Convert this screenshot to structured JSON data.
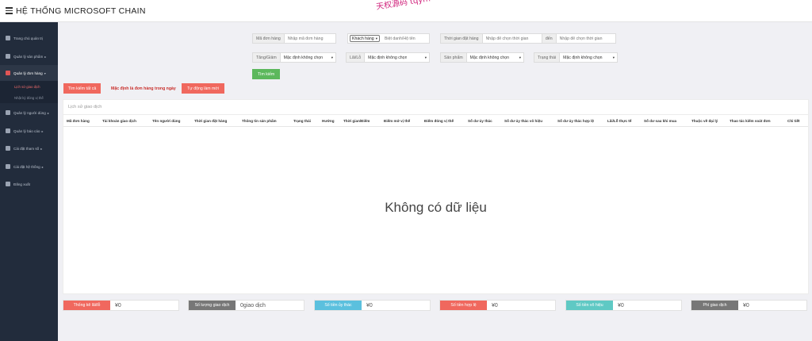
{
  "topbar": {
    "title": "HỆ THỐNG MICROSOFT CHAIN",
    "watermark": "天权源码 tqym"
  },
  "sidebar": {
    "items": [
      {
        "label": "Trang chủ quản trị",
        "chevron": ""
      },
      {
        "label": "Quản lý sản phẩm",
        "chevron": "▸"
      },
      {
        "label": "Quản lý đơn hàng",
        "chevron": "▾"
      },
      {
        "label": "Quản lý người dùng",
        "chevron": "▸"
      },
      {
        "label": "Quản lý báo cáo",
        "chevron": "▸"
      },
      {
        "label": "Cài đặt tham số",
        "chevron": "▸"
      },
      {
        "label": "Cài đặt hệ thống",
        "chevron": "▸"
      },
      {
        "label": "Đăng xuất",
        "chevron": ""
      }
    ],
    "sub_items": [
      "Lịch sử giao dịch",
      "Nhật ký đóng vị thế"
    ]
  },
  "filters": {
    "order_code": {
      "label": "Mã đơn hàng",
      "placeholder": "Nhập mã đơn hàng"
    },
    "customer": {
      "select": "Khách hàng",
      "placeholder": "Biệt danh/Hộ tên"
    },
    "order_time": {
      "label": "Thời gian đặt hàng",
      "placeholder_from": "Nhập để chọn thời gian",
      "sep": "đến",
      "placeholder_to": "Nhập để chọn thời gian"
    },
    "direction": {
      "label": "Tăng/Giảm",
      "value": "Mặc định không chọn"
    },
    "pnl": {
      "label": "Lãi/Lỗ",
      "value": "Mặc định không chọn"
    },
    "product": {
      "label": "Sản phẩm",
      "value": "Mặc định không chọn"
    },
    "status": {
      "label": "Trạng thái",
      "value": "Mặc định không chọn"
    },
    "search_button": "Tìm kiếm"
  },
  "actions": {
    "search_all": "Tìm kiếm tất cả",
    "note": "Mặc định là đơn hàng trong ngày",
    "auto_refresh": "Tự động làm mới"
  },
  "table": {
    "title": "Lịch sử giao dịch",
    "columns": [
      "Mã đơn hàng",
      "Tài khoản giao dịch",
      "Tên người dùng",
      "Thời gian đặt hàng",
      "Thông tin sản phẩm",
      "Trạng thái",
      "Hướng",
      "Thời gian/Điểm",
      "Điểm mở vị thế",
      "Điểm đóng vị thế",
      "Số dư ủy thác",
      "Số dư ủy thác vô hiệu",
      "Số dư ủy thác hợp lệ",
      "Lãi/Lỗ thực tế",
      "Số dư sau khi mua",
      "Thuộc về đại lý",
      "Thao tác kiểm soát đơn",
      "Chi tiết"
    ],
    "empty_text": "Không có dữ liệu"
  },
  "stats": [
    {
      "label": "Thống kê lãi/lỗ",
      "value": "¥0",
      "color": "#f0685e"
    },
    {
      "label": "Số lượng giao dịch",
      "value": "0giao dịch",
      "color": "#777777"
    },
    {
      "label": "Số tiền ủy thác",
      "value": "¥0",
      "color": "#5bc0de"
    },
    {
      "label": "Số tiền hợp lệ",
      "value": "¥0",
      "color": "#f0685e"
    },
    {
      "label": "Số tiền vô hiệu",
      "value": "¥0",
      "color": "#5fc9c4"
    },
    {
      "label": "Phí giao dịch",
      "value": "¥0",
      "color": "#777777"
    }
  ]
}
